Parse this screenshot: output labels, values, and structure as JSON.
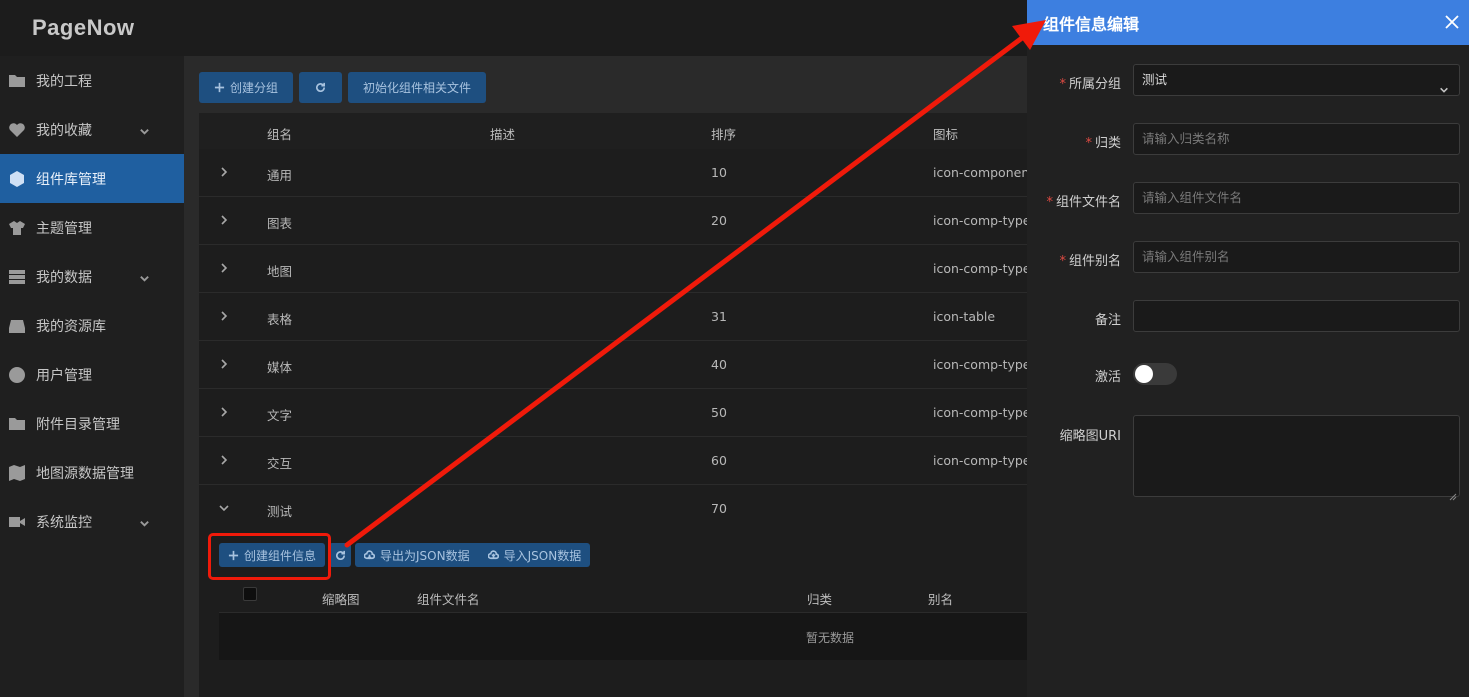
{
  "app": {
    "logo": "PageNow"
  },
  "sidebar": {
    "items": [
      {
        "label": "我的工程",
        "icon": "folder-icon",
        "has_chevron": false,
        "active": false
      },
      {
        "label": "我的收藏",
        "icon": "heart-icon",
        "has_chevron": true,
        "active": false
      },
      {
        "label": "组件库管理",
        "icon": "cube-icon",
        "has_chevron": false,
        "active": true
      },
      {
        "label": "主题管理",
        "icon": "shirt-icon",
        "has_chevron": false,
        "active": false
      },
      {
        "label": "我的数据",
        "icon": "database-icon",
        "has_chevron": true,
        "active": false
      },
      {
        "label": "我的资源库",
        "icon": "inbox-icon",
        "has_chevron": false,
        "active": false
      },
      {
        "label": "用户管理",
        "icon": "user-icon",
        "has_chevron": false,
        "active": false
      },
      {
        "label": "附件目录管理",
        "icon": "folder-icon",
        "has_chevron": false,
        "active": false
      },
      {
        "label": "地图源数据管理",
        "icon": "map-icon",
        "has_chevron": false,
        "active": false
      },
      {
        "label": "系统监控",
        "icon": "video-icon",
        "has_chevron": true,
        "active": false
      }
    ]
  },
  "toolbar": {
    "create_group": "创建分组",
    "init_files": "初始化组件相关文件"
  },
  "table": {
    "headers": {
      "name": "组名",
      "desc": "描述",
      "order": "排序",
      "icon": "图标"
    },
    "rows": [
      {
        "name": "通用",
        "desc": "",
        "order": "10",
        "icon": "icon-component"
      },
      {
        "name": "图表",
        "desc": "",
        "order": "20",
        "icon": "icon-comp-type-"
      },
      {
        "name": "地图",
        "desc": "",
        "order": "",
        "icon": "icon-comp-type-"
      },
      {
        "name": "表格",
        "desc": "",
        "order": "31",
        "icon": "icon-table"
      },
      {
        "name": "媒体",
        "desc": "",
        "order": "40",
        "icon": "icon-comp-type-"
      },
      {
        "name": "文字",
        "desc": "",
        "order": "50",
        "icon": "icon-comp-type-"
      },
      {
        "name": "交互",
        "desc": "",
        "order": "60",
        "icon": "icon-comp-type-"
      },
      {
        "name": "测试",
        "desc": "",
        "order": "70",
        "icon": ""
      }
    ]
  },
  "sub": {
    "create_component": "创建组件信息",
    "export_json": "导出为JSON数据",
    "import_json": "导入JSON数据",
    "headers": {
      "thumb": "缩略图",
      "filename": "组件文件名",
      "category": "归类",
      "alias": "别名"
    },
    "empty": "暂无数据"
  },
  "drawer": {
    "title": "组件信息编辑",
    "fields": {
      "group": {
        "label": "所属分组",
        "value": "测试"
      },
      "category": {
        "label": "归类",
        "placeholder": "请输入归类名称"
      },
      "filename": {
        "label": "组件文件名",
        "placeholder": "请输入组件文件名"
      },
      "alias": {
        "label": "组件别名",
        "placeholder": "请输入组件别名"
      },
      "remark": {
        "label": "备注",
        "value": ""
      },
      "active": {
        "label": "激活",
        "on": false
      },
      "thumb_uri": {
        "label": "缩略图URI",
        "value": ""
      }
    },
    "required_mark": "*"
  },
  "colors": {
    "accent": "#3d7fe0",
    "sidebar_active": "#1f5fa0",
    "button": "#1e4f80",
    "annotation": "#f01a0a"
  }
}
